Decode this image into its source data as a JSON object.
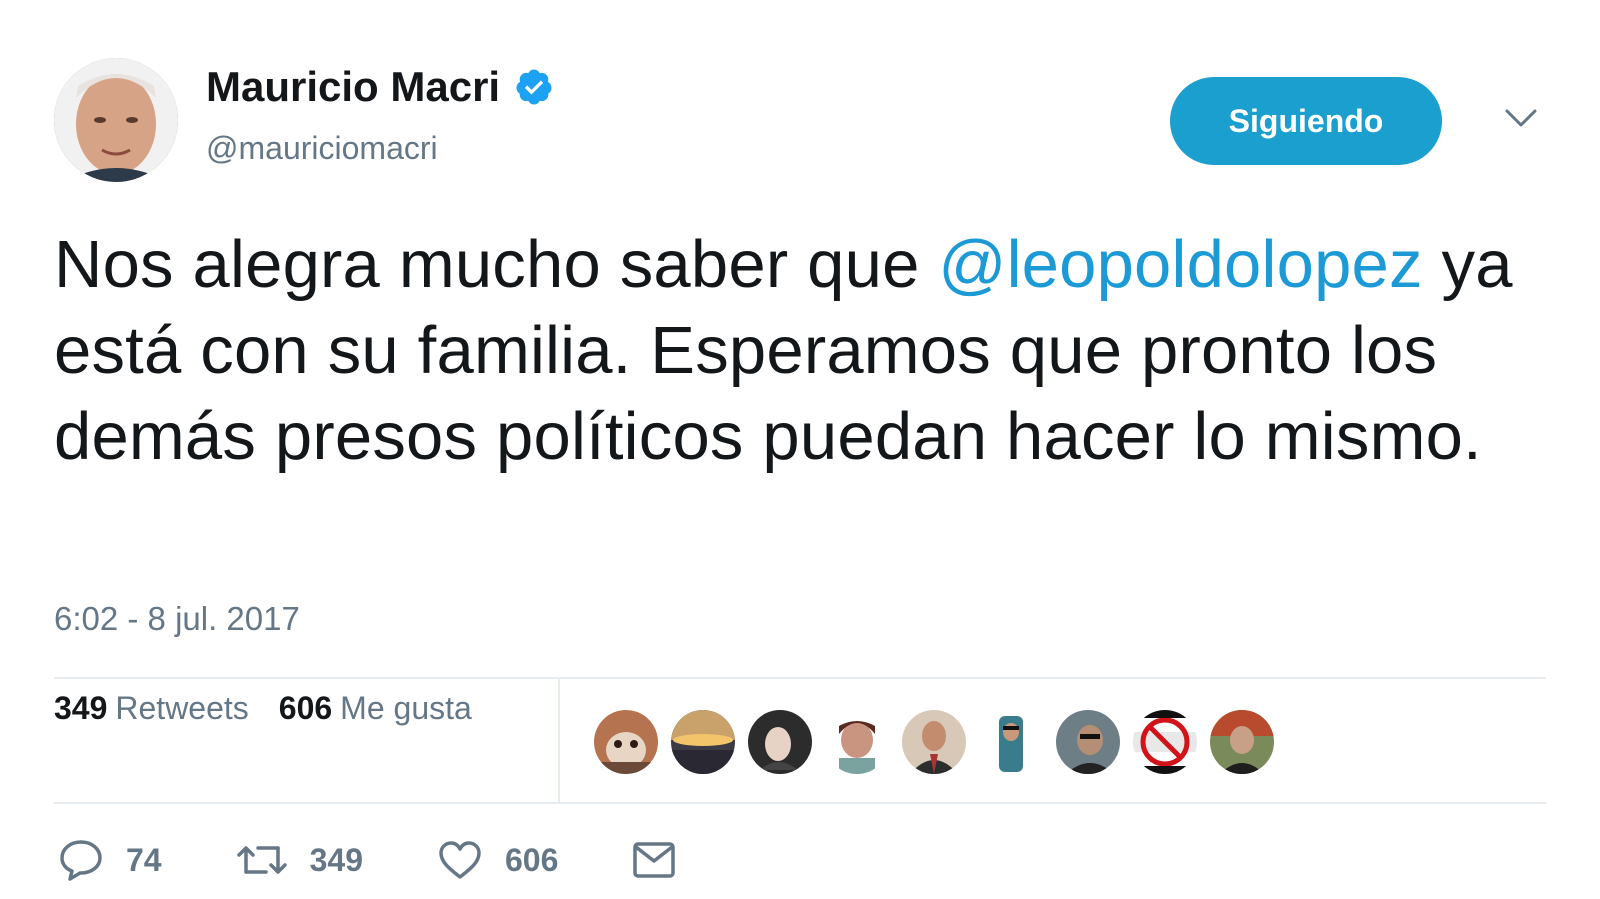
{
  "author": {
    "display_name": "Mauricio Macri",
    "handle": "@mauriciomacri",
    "verified": true,
    "avatar": "avatar-photo"
  },
  "follow_button": {
    "label": "Siguiendo"
  },
  "more_menu": {
    "icon": "chevron-down-icon"
  },
  "tweet": {
    "text_before": "Nos alegra mucho saber que ",
    "mention": "@leopoldolopez",
    "text_after": " ya está con su familia. Esperamos que pronto los demás presos políticos puedan hacer lo mismo.",
    "timestamp": "6:02 - 8 jul. 2017"
  },
  "stats": {
    "retweets_count": "349",
    "retweets_label": "Retweets",
    "likes_count": "606",
    "likes_label": "Me gusta"
  },
  "likers": [
    {
      "icon": "liker-avatar-1"
    },
    {
      "icon": "liker-avatar-2"
    },
    {
      "icon": "liker-avatar-3"
    },
    {
      "icon": "liker-avatar-4"
    },
    {
      "icon": "liker-avatar-5"
    },
    {
      "icon": "liker-avatar-6"
    },
    {
      "icon": "liker-avatar-7"
    },
    {
      "icon": "liker-avatar-8"
    },
    {
      "icon": "liker-avatar-9"
    }
  ],
  "actions": {
    "reply": {
      "icon": "reply-icon",
      "count": "74"
    },
    "retweet": {
      "icon": "retweet-icon",
      "count": "349"
    },
    "like": {
      "icon": "heart-icon",
      "count": "606"
    },
    "message": {
      "icon": "envelope-icon"
    }
  },
  "colors": {
    "accent": "#1a9fcf",
    "link": "#1c9ad6",
    "muted": "#657786",
    "text": "#14171a",
    "divider": "#e6ecf0"
  }
}
